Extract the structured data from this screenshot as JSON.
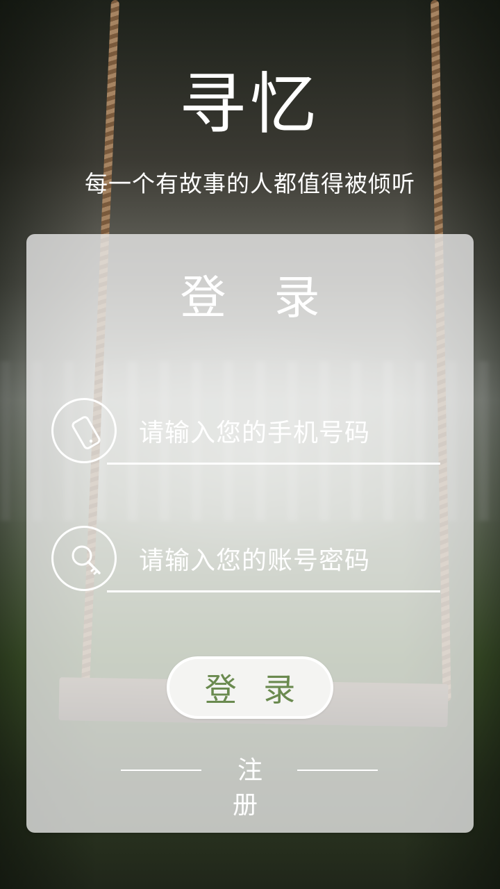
{
  "app": {
    "title": "寻忆",
    "subtitle": "每一个有故事的人都值得被倾听"
  },
  "login_card": {
    "title": "登 录",
    "phone_field": {
      "placeholder": "请输入您的手机号码",
      "value": "",
      "icon": "phone-icon"
    },
    "password_field": {
      "placeholder": "请输入您的账号密码",
      "value": "",
      "icon": "key-icon"
    },
    "login_button_label": "登 录",
    "register_link_label": "注 册"
  },
  "colors": {
    "accent": "#6a8a4f",
    "card_bg": "#ececec",
    "text": "#ffffff"
  }
}
